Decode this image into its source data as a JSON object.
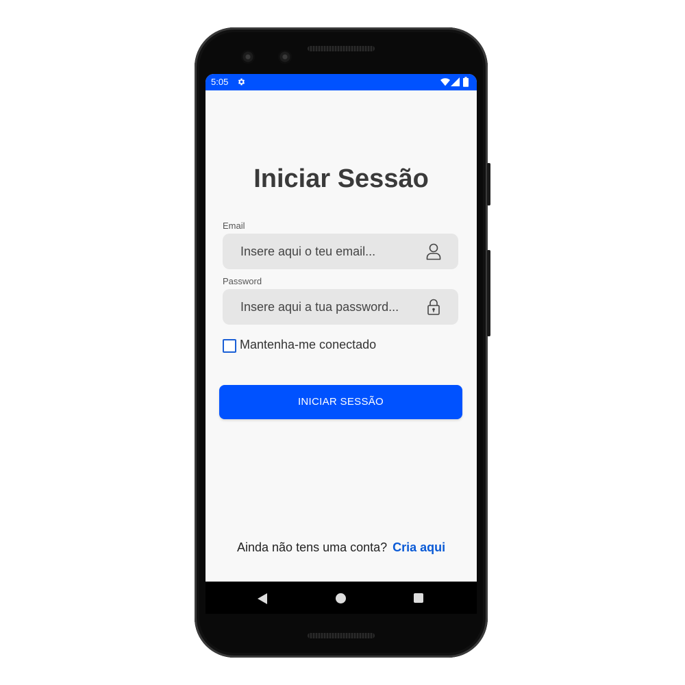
{
  "statusbar": {
    "time": "5:05",
    "icons": [
      "gear-icon",
      "wifi-icon",
      "signal-icon",
      "battery-icon"
    ],
    "background": "#0052ff"
  },
  "login": {
    "title": "Iniciar Sessão",
    "email_label": "Email",
    "email_placeholder": "Insere aqui o teu email...",
    "email_value": "",
    "email_icon": "user-icon",
    "password_label": "Password",
    "password_placeholder": "Insere aqui a tua password...",
    "password_value": "",
    "password_icon": "lock-icon",
    "remember_label": "Mantenha-me conectado",
    "remember_checked": false,
    "submit_label": "INICIAR SESSÃO",
    "signup_prompt": "Ainda não tens uma conta?",
    "signup_link": "Cria aqui"
  },
  "navbar": {
    "icons": [
      "back-icon",
      "home-icon",
      "recent-apps-icon"
    ]
  },
  "colors": {
    "accent": "#0052ff",
    "link": "#0a5ad6",
    "field_background": "#e6e6e6",
    "title": "#3a3a3a"
  }
}
